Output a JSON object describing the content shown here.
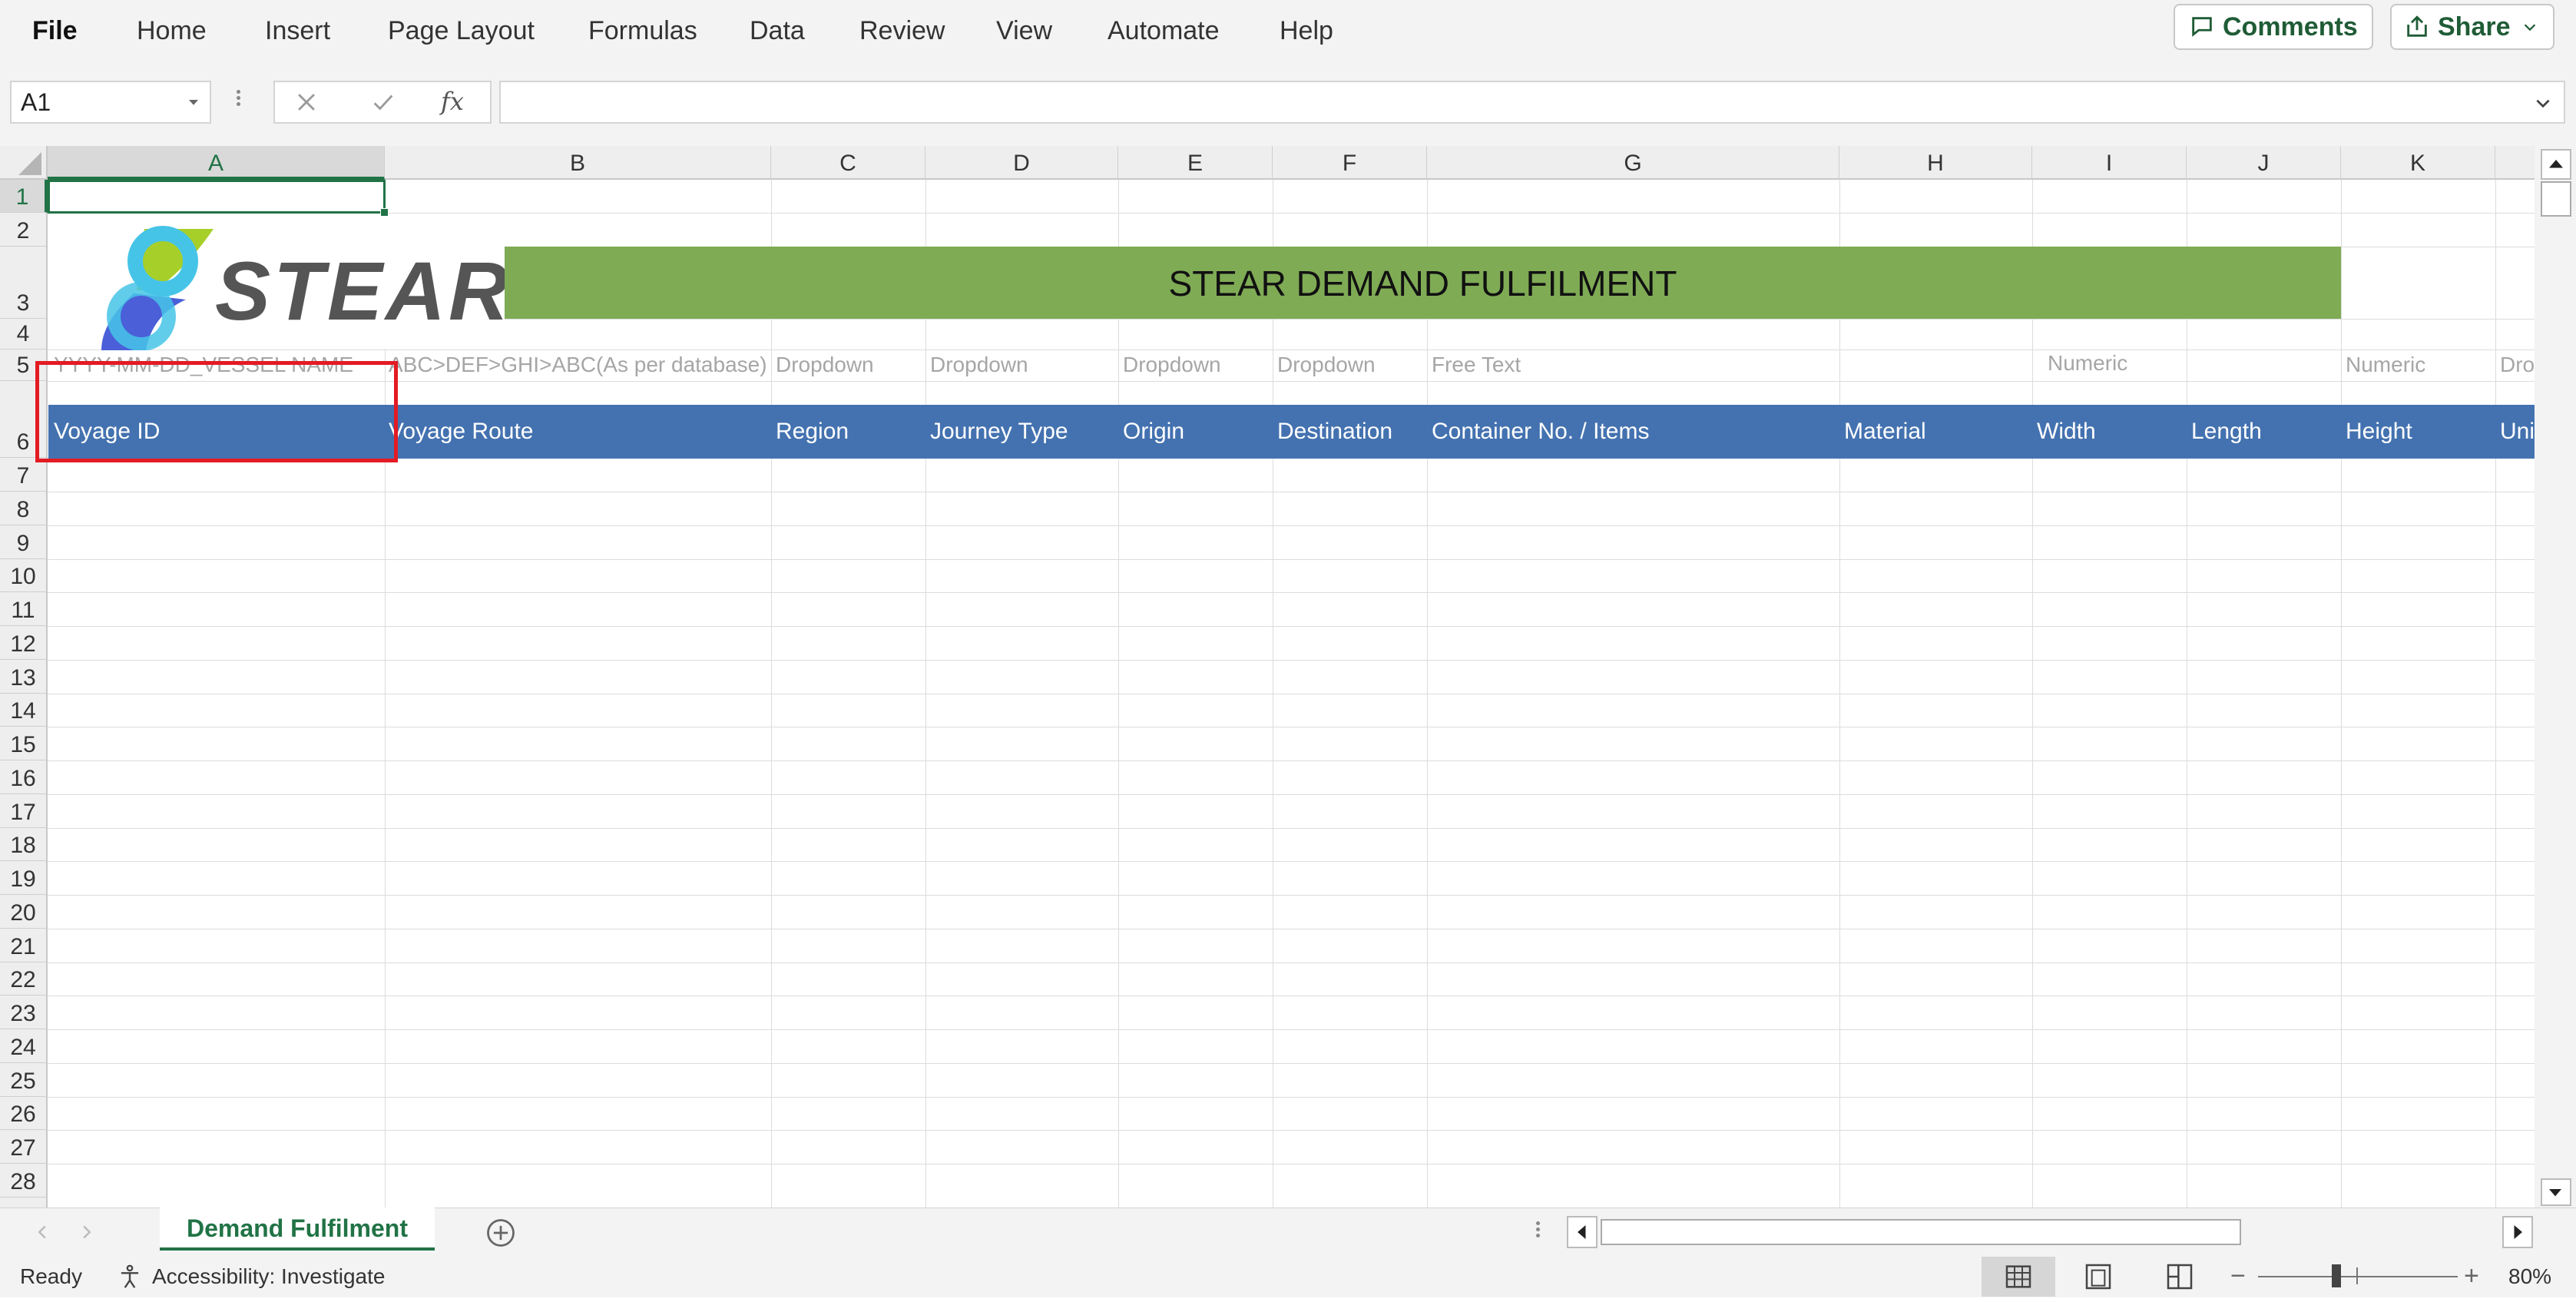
{
  "ribbon": {
    "tabs": [
      "File",
      "Home",
      "Insert",
      "Page Layout",
      "Formulas",
      "Data",
      "Review",
      "View",
      "Automate",
      "Help"
    ],
    "comments_label": "Comments",
    "share_label": "Share"
  },
  "formula_bar": {
    "name_box": "A1",
    "formula": ""
  },
  "columns": [
    "A",
    "B",
    "C",
    "D",
    "E",
    "F",
    "G",
    "H",
    "I",
    "J",
    "K"
  ],
  "rows": [
    "1",
    "2",
    "3",
    "4",
    "5",
    "6",
    "7",
    "8",
    "9",
    "10",
    "11",
    "12",
    "13",
    "14",
    "15",
    "16",
    "17",
    "18",
    "19",
    "20",
    "21",
    "22",
    "23",
    "24",
    "25",
    "26",
    "27",
    "28"
  ],
  "sheet": {
    "logo_text": "STEAR",
    "banner_title": "STEAR DEMAND FULFILMENT",
    "hints": {
      "A": "YYYY-MM-DD_VESSEL NAME",
      "B": "ABC>DEF>GHI>ABC(As per database)",
      "C": "Dropdown",
      "D": "Dropdown",
      "E": "Dropdown",
      "F": "Dropdown",
      "G": "Free Text",
      "HI": "Numeric",
      "K": "Numeric",
      "L": "Dro"
    },
    "headers": {
      "A": "Voyage ID",
      "B": "Voyage Route",
      "C": "Region",
      "D": "Journey Type",
      "E": "Origin",
      "F": "Destination",
      "G": "Container No. / Items",
      "H": "Material",
      "I": "Width",
      "J": "Length",
      "K": "Height",
      "L": "Uni"
    },
    "colors": {
      "banner": "#7fab55",
      "header_row": "#4472b0",
      "highlight_box": "#e31b23",
      "accent": "#217346"
    }
  },
  "sheet_tabs": {
    "active": "Demand Fulfilment"
  },
  "status": {
    "ready": "Ready",
    "accessibility": "Accessibility: Investigate",
    "zoom": "80%"
  },
  "icons": [
    "comment-icon",
    "share-icon",
    "chevron-down-icon",
    "cancel-icon",
    "enter-icon",
    "fx-icon",
    "add-sheet-icon",
    "normal-view-icon",
    "page-layout-icon",
    "page-break-icon",
    "accessibility-icon"
  ]
}
